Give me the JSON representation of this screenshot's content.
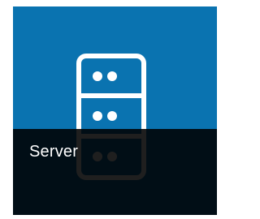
{
  "tile": {
    "label": "Server",
    "icon": "server-icon"
  },
  "colors": {
    "tile_background": "#0a73b0",
    "caption_bar": "#000000",
    "caption_text": "#ffffff",
    "icon_stroke": "#ffffff"
  }
}
